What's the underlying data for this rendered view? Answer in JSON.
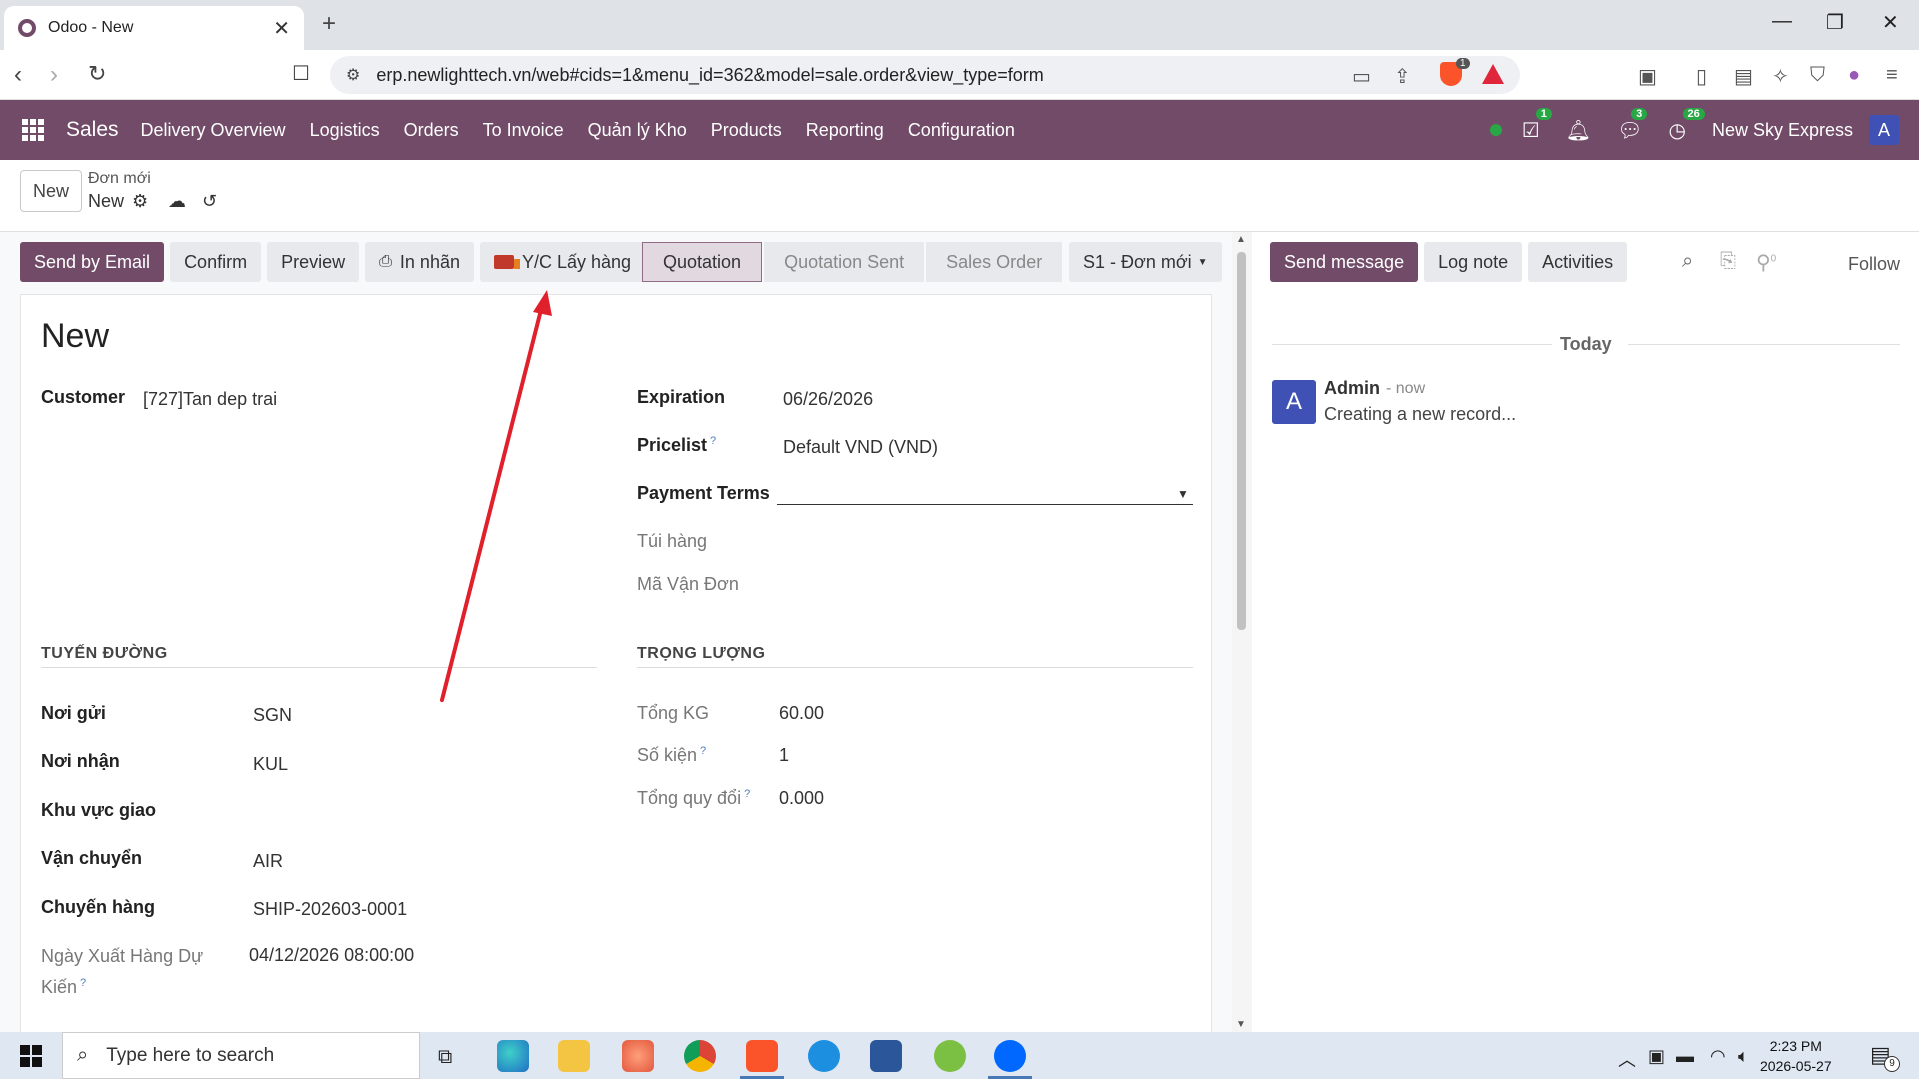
{
  "browser": {
    "tab_title": "Odoo - New",
    "new_tab": "+",
    "url": "erp.newlighttech.vn/web#cids=1&menu_id=362&model=sale.order&view_type=form",
    "brave_badge": "1"
  },
  "navbar": {
    "app_name": "Sales",
    "menu": [
      "Delivery Overview",
      "Logistics",
      "Orders",
      "To Invoice",
      "Quản lý Kho",
      "Products",
      "Reporting",
      "Configuration"
    ],
    "activity_count": "1",
    "messages_count": "3",
    "clock_count": "26",
    "company": "New Sky Express",
    "avatar_initial": "A",
    "color": "#714b67"
  },
  "control_panel": {
    "new_label": "New",
    "breadcrumb_parent": "Đơn mới",
    "breadcrumb_current": "New"
  },
  "actions": {
    "send_email": "Send by Email",
    "confirm": "Confirm",
    "preview": "Preview",
    "print_label": "In nhãn",
    "pickup_request": "Y/C Lấy hàng"
  },
  "stages": {
    "items": [
      "Quotation",
      "Quotation Sent",
      "Sales Order"
    ],
    "active": "Quotation",
    "dropdown": "S1 - Đơn mới"
  },
  "form": {
    "title": "New",
    "customer_label": "Customer",
    "customer_value": "[727]Tan dep trai",
    "expiration_label": "Expiration",
    "expiration_value": "06/26/2026",
    "pricelist_label": "Pricelist",
    "pricelist_value": "Default VND (VND)",
    "payment_terms_label": "Payment Terms",
    "payment_terms_value": "",
    "tui_hang_label": "Túi hàng",
    "ma_van_don_label": "Mã Vận Đơn",
    "route_section": "TUYẾN ĐƯỜNG",
    "weight_section": "TRỌNG LƯỢNG",
    "noi_gui_label": "Nơi gửi",
    "noi_gui_value": "SGN",
    "noi_nhan_label": "Nơi nhận",
    "noi_nhan_value": "KUL",
    "khu_vuc_label": "Khu vực giao",
    "van_chuyen_label": "Vận chuyển",
    "van_chuyen_value": "AIR",
    "chuyen_hang_label": "Chuyến hàng",
    "chuyen_hang_value": "SHIP-202603-0001",
    "ngay_xuat_label": "Ngày Xuất Hàng Dự Kiến",
    "ngay_xuat_value": "04/12/2026 08:00:00",
    "tong_kg_label": "Tổng KG",
    "tong_kg_value": "60.00",
    "so_kien_label": "Số kiện",
    "so_kien_value": "1",
    "tong_quy_doi_label": "Tổng quy đổi",
    "tong_quy_doi_value": "0.000",
    "help_mark": "?"
  },
  "chatter": {
    "send_message": "Send message",
    "log_note": "Log note",
    "activities": "Activities",
    "followers_count": "0",
    "follow": "Follow",
    "today": "Today",
    "message": {
      "avatar": "A",
      "author": "Admin",
      "time": "- now",
      "body": "Creating a new record..."
    }
  },
  "taskbar": {
    "search_placeholder": "Type here to search",
    "time": "2:23 PM",
    "date": "2026-05-27",
    "notifications": "9"
  },
  "annotation_color": "#e0202a"
}
